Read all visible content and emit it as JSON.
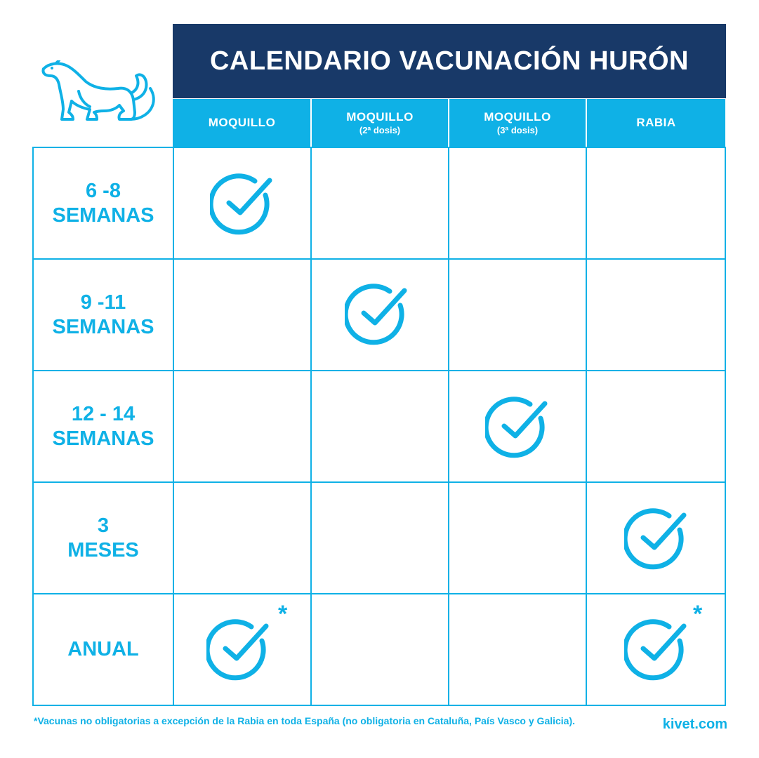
{
  "title": "CALENDARIO VACUNACIÓN HURÓN",
  "columns": [
    {
      "label": "MOQUILLO",
      "sub": ""
    },
    {
      "label": "MOQUILLO",
      "sub": "(2ª dosis)"
    },
    {
      "label": "MOQUILLO",
      "sub": "(3ª dosis)"
    },
    {
      "label": "RABIA",
      "sub": ""
    }
  ],
  "rows": [
    {
      "line1": "6 -8",
      "line2": "SEMANAS"
    },
    {
      "line1": "9 -11",
      "line2": "SEMANAS"
    },
    {
      "line1": "12 - 14",
      "line2": "SEMANAS"
    },
    {
      "line1": "3",
      "line2": "MESES"
    },
    {
      "line1": "ANUAL",
      "line2": ""
    }
  ],
  "asterisk": "*",
  "footnote": "*Vacunas no obligatorias a excepción de la Rabia en toda España (no obligatoria en Cataluña, País Vasco y Galicia).",
  "brand": "kivet.com",
  "icons": {
    "logo": "ferret-icon",
    "mark": "check-circle-icon"
  },
  "colors": {
    "title_bg": "#183968",
    "accent": "#0fb1e6",
    "background": "#ffffff"
  }
}
